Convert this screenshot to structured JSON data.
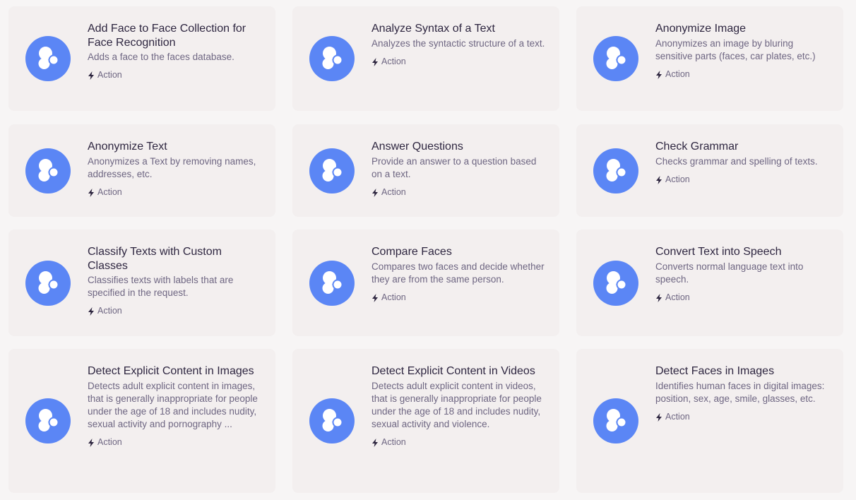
{
  "brand_color": "#5b86f5",
  "tag_icon": "bolt-icon",
  "cards": [
    {
      "title": "Add Face to Face Collection for Face Recognition",
      "description": "Adds a face to the faces database.",
      "tag": "Action"
    },
    {
      "title": "Analyze Syntax of a Text",
      "description": "Analyzes the syntactic structure of a text.",
      "tag": "Action"
    },
    {
      "title": "Anonymize Image",
      "description": "Anonymizes an image by bluring sensitive parts (faces, car plates, etc.)",
      "tag": "Action"
    },
    {
      "title": "Anonymize Text",
      "description": "Anonymizes a Text by removing names, addresses, etc.",
      "tag": "Action"
    },
    {
      "title": "Answer Questions",
      "description": "Provide an answer to a question based on a text.",
      "tag": "Action"
    },
    {
      "title": "Check Grammar",
      "description": "Checks grammar and spelling of texts.",
      "tag": "Action"
    },
    {
      "title": "Classify Texts with Custom Classes",
      "description": "Classifies texts with labels that are specified in the request.",
      "tag": "Action"
    },
    {
      "title": "Compare Faces",
      "description": "Compares two faces and decide whether they are from the same person.",
      "tag": "Action"
    },
    {
      "title": "Convert Text into Speech",
      "description": "Converts normal language text into speech.",
      "tag": "Action"
    },
    {
      "title": "Detect Explicit Content in Images",
      "description": "Detects adult explicit content in images, that is generally inappropriate for people under the age of 18 and includes nudity, sexual activity and pornography ...",
      "tag": "Action"
    },
    {
      "title": "Detect Explicit Content in Videos",
      "description": "Detects adult explicit content in videos, that is generally inappropriate for people under the age of 18 and includes nudity, sexual activity and violence.",
      "tag": "Action"
    },
    {
      "title": "Detect Faces in Images",
      "description": "Identifies human faces in digital images: position, sex, age, smile, glasses, etc.",
      "tag": "Action"
    }
  ]
}
